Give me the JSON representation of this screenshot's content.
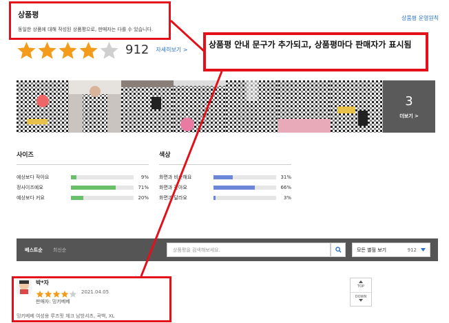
{
  "header": {
    "section_title": "상품평",
    "notice": "동일한 상품에 대해 작성된 상품평으로, 판매자는 다를 수 있습니다.",
    "policy_link": "상품평 운영원칙"
  },
  "rating": {
    "stars_filled": 4,
    "stars_total": 5,
    "count": "912",
    "detail_link": "자세히보기 >"
  },
  "annotation": {
    "text": "상품평 안내 문구가 추가되고, 상품평마다 판매자가 표시됨"
  },
  "photos": {
    "more_count": "3",
    "more_label": "더보기 >"
  },
  "size_stats": {
    "title": "사이즈",
    "rows": [
      {
        "label": "예상보다 작아요",
        "percent_text": "9%",
        "fraction": 0.09
      },
      {
        "label": "정사이즈예요",
        "percent_text": "71%",
        "fraction": 0.71
      },
      {
        "label": "예상보다 커요",
        "percent_text": "20%",
        "fraction": 0.2
      }
    ],
    "bar_color": "#6abf69"
  },
  "color_stats": {
    "title": "색상",
    "rows": [
      {
        "label": "화면과 비슷해요",
        "percent_text": "31%",
        "fraction": 0.31
      },
      {
        "label": "화면과 같아요",
        "percent_text": "66%",
        "fraction": 0.66
      },
      {
        "label": "화면과 달라요",
        "percent_text": "3%",
        "fraction": 0.03
      }
    ],
    "bar_color": "#6c86d8"
  },
  "filter": {
    "sort_best": "베스트순",
    "sort_recent": "최신순",
    "search_placeholder": "상품평을 검색해보세요.",
    "option_label": "모든 별점 보기",
    "option_count": "912"
  },
  "review": {
    "author": "박*자",
    "stars_filled": 4,
    "date": "2021.04.05",
    "seller": "판매자: 밍키베베",
    "product_option": "밍키베베 여성용 루즈핏 체크 남방셔츠, 곡백, XL"
  },
  "scroll_nav": {
    "top": "TOP",
    "down": "DOWN"
  },
  "colors": {
    "accent_red": "#e3101a",
    "star_orange": "#f39b1a",
    "link_blue": "#2a73c8"
  }
}
